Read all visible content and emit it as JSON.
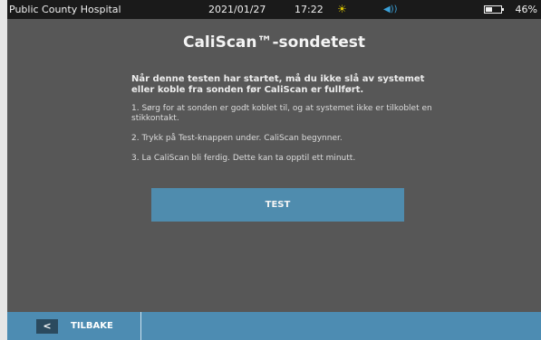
{
  "status_bar": {
    "facility": "Public County Hospital",
    "date": "2021/01/27",
    "time": "17:22",
    "brightness_icon": "sun-icon",
    "volume_icon": "speaker-icon",
    "battery_icon": "battery-icon",
    "battery_level": 0.46,
    "battery_percent": "46%"
  },
  "main": {
    "title": "CaliScan™-sondetest",
    "warning": "Når denne testen har startet, må du ikke slå av systemet eller koble fra sonden før CaliScan er fullført.",
    "steps": [
      "1. Sørg for at sonden er godt koblet til, og at systemet ikke er tilkoblet en stikkontakt.",
      "2. Trykk på Test-knappen under. CaliScan begynner.",
      "3. La CaliScan bli ferdig. Dette kan ta opptil ett minutt."
    ],
    "test_button_label": "TEST"
  },
  "bottom_bar": {
    "back_icon": "chevron-left-icon",
    "back_label": "TILBAKE"
  },
  "colors": {
    "background": "#575757",
    "status_bar": "#1a1a1a",
    "accent": "#4f8cae",
    "bottom_bar": "#4d8cb2"
  }
}
